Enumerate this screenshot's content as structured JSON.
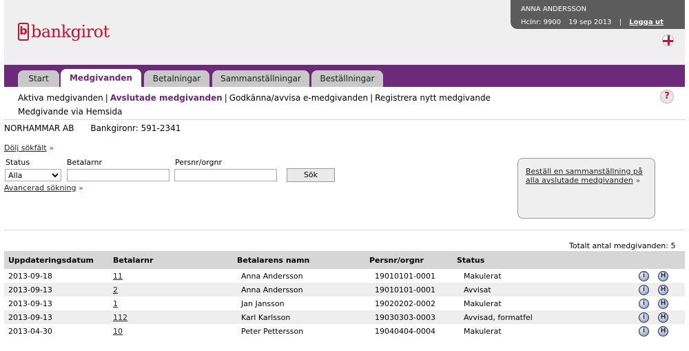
{
  "brand": {
    "name": "bankgirot",
    "logo_letter": "b"
  },
  "user": {
    "name": "ANNA ANDERSSON",
    "clnr": "Hclnr: 9900",
    "date": "19 sep 2013",
    "sep": "|",
    "logout": "Logga ut"
  },
  "tabs": [
    {
      "label": "Start"
    },
    {
      "label": "Medgivanden"
    },
    {
      "label": "Betalningar"
    },
    {
      "label": "Sammanställningar"
    },
    {
      "label": "Beställningar"
    }
  ],
  "subnav": [
    {
      "label": "Aktiva medgivanden"
    },
    {
      "label": "Avslutade medgivanden"
    },
    {
      "label": "Godkänna/avvisa e-medgivanden"
    },
    {
      "label": "Registrera nytt medgivande"
    },
    {
      "label": "Medgivande via Hemsida"
    }
  ],
  "help": "?",
  "company": {
    "name": "NORHAMMAR AB",
    "bankgiro": "Bankgironr: 591-2341"
  },
  "search": {
    "hide_label": "Dölj sökfält",
    "status_label": "Status",
    "status_value": "Alla",
    "betalarnr_label": "Betalarnr",
    "betalarnr_value": "",
    "persnr_label": "Persnr/orgnr",
    "persnr_value": "",
    "button": "Sök",
    "advanced": "Avancerad sökning"
  },
  "order_box": {
    "text": "Beställ en sammanställning på alla avslutade medgivanden"
  },
  "total": "Totalt antal medgivanden: 5",
  "table": {
    "headers": [
      "Uppdateringsdatum",
      "Betalarnr",
      "Betalarens namn",
      "Persnr/orgnr",
      "Status"
    ],
    "rows": [
      {
        "date": "2013-09-18",
        "nr": "11",
        "name": "Anna Andersson",
        "pnr": "19010101-0001",
        "status": "Makulerat"
      },
      {
        "date": "2013-09-13",
        "nr": "2",
        "name": "Anna Andersson",
        "pnr": "19010101-0001",
        "status": "Avvisat"
      },
      {
        "date": "2013-09-13",
        "nr": "1",
        "name": "Jan Jansson",
        "pnr": "19020202-0002",
        "status": "Makulerat"
      },
      {
        "date": "2013-09-13",
        "nr": "112",
        "name": "Karl Karlsson",
        "pnr": "19030303-0003",
        "status": "Avvisad, formatfel"
      },
      {
        "date": "2013-04-30",
        "nr": "10",
        "name": "Peter Pettersson",
        "pnr": "19040404-0004",
        "status": "Makulerat"
      }
    ],
    "icon_info": "i",
    "icon_history": "H"
  },
  "arrow": "»"
}
